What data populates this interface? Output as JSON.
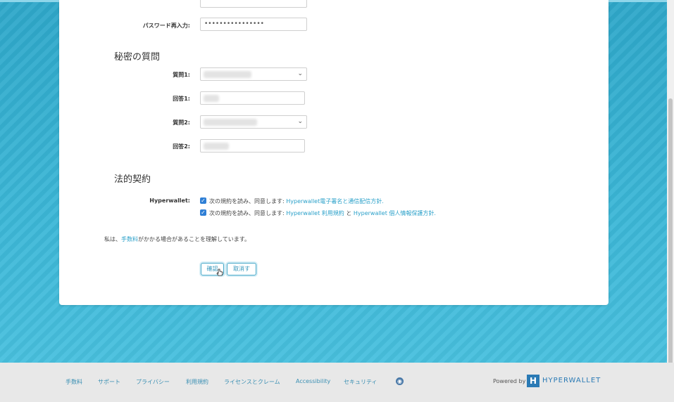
{
  "form": {
    "password_confirm_label": "パスワード再入力:",
    "password_confirm_value": "••••••••••••••••",
    "security_section_title": "秘密の質問",
    "q1_label": "質問1:",
    "a1_label": "回答1:",
    "q2_label": "質問2:",
    "a2_label": "回答2:",
    "legal_section_title": "法的契約",
    "hyperwallet_label": "Hyperwallet:",
    "agree1_prefix": "次の規約を読み、同意します:",
    "agree1_link": "Hyperwallet電子署名と通信配信方針.",
    "agree2_prefix": "次の規約を読み、同意します:",
    "agree2_link1": "Hyperwallet 利用規約",
    "agree2_and": "と",
    "agree2_link2": "Hyperwallet 個人情報保護方針.",
    "fee_notice_prefix": "私は、",
    "fee_notice_link": "手数料",
    "fee_notice_suffix": "がかかる場合があることを理解しています。",
    "confirm_button": "確認",
    "cancel_button": "取消す"
  },
  "footer": {
    "links": [
      "手数料",
      "サポート",
      "プライバシー",
      "利用規約",
      "ライセンスとクレーム",
      "Accessibility",
      "セキュリティ"
    ],
    "powered_by": "Powered by",
    "brand": "HYPERWALLET"
  },
  "colors": {
    "accent": "#2aa0c9",
    "background": "#3ab8d6",
    "checkbox": "#2f7fd5"
  }
}
